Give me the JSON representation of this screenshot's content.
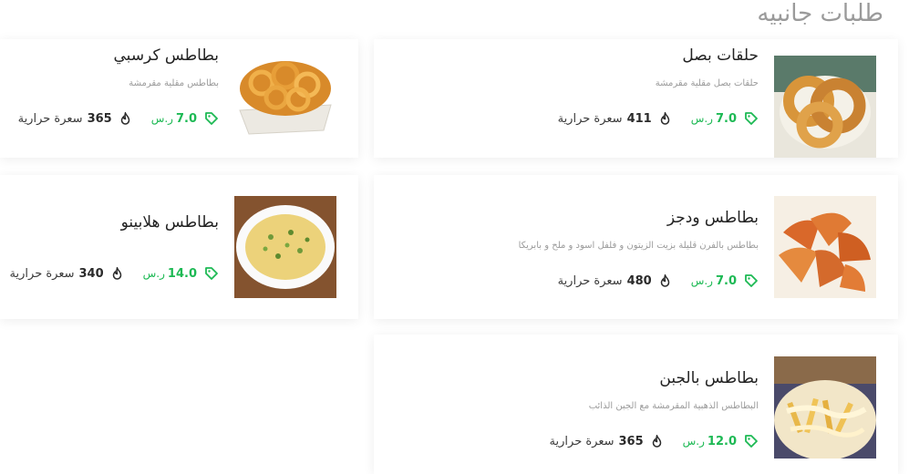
{
  "section": {
    "title": "طلبات جانبيه"
  },
  "currency": "ر.س",
  "calories_label": "سعرة حرارية",
  "items": [
    {
      "name": "حلقات بصل",
      "description": "حلقات بصل مقلية مقرمشة",
      "price": "7.0",
      "calories": "411",
      "image": "onion-rings-image"
    },
    {
      "name": "بطاطس كرسبي",
      "description": "بطاطس مقلية مقرمشة",
      "price": "7.0",
      "calories": "365",
      "image": "curly-fries-image"
    },
    {
      "name": "بطاطس ودجز",
      "description": "بطاطس بالفرن قليلة بزيت الزيتون و فلفل اسود و ملح و بابريكا",
      "price": "7.0",
      "calories": "480",
      "image": "potato-wedges-image"
    },
    {
      "name": "بطاطس هلابينو",
      "description": "",
      "price": "14.0",
      "calories": "340",
      "image": "jalapeno-fries-image"
    },
    {
      "name": "بطاطس بالجبن",
      "description": "البطاطس الذهبية المقرمشة مع الجبن الذائب",
      "price": "12.0",
      "calories": "365",
      "image": "cheese-fries-image"
    }
  ],
  "colors": {
    "accent": "#1db954",
    "title": "#9a9a9a",
    "text": "#222222",
    "muted": "#9b9b9b"
  }
}
